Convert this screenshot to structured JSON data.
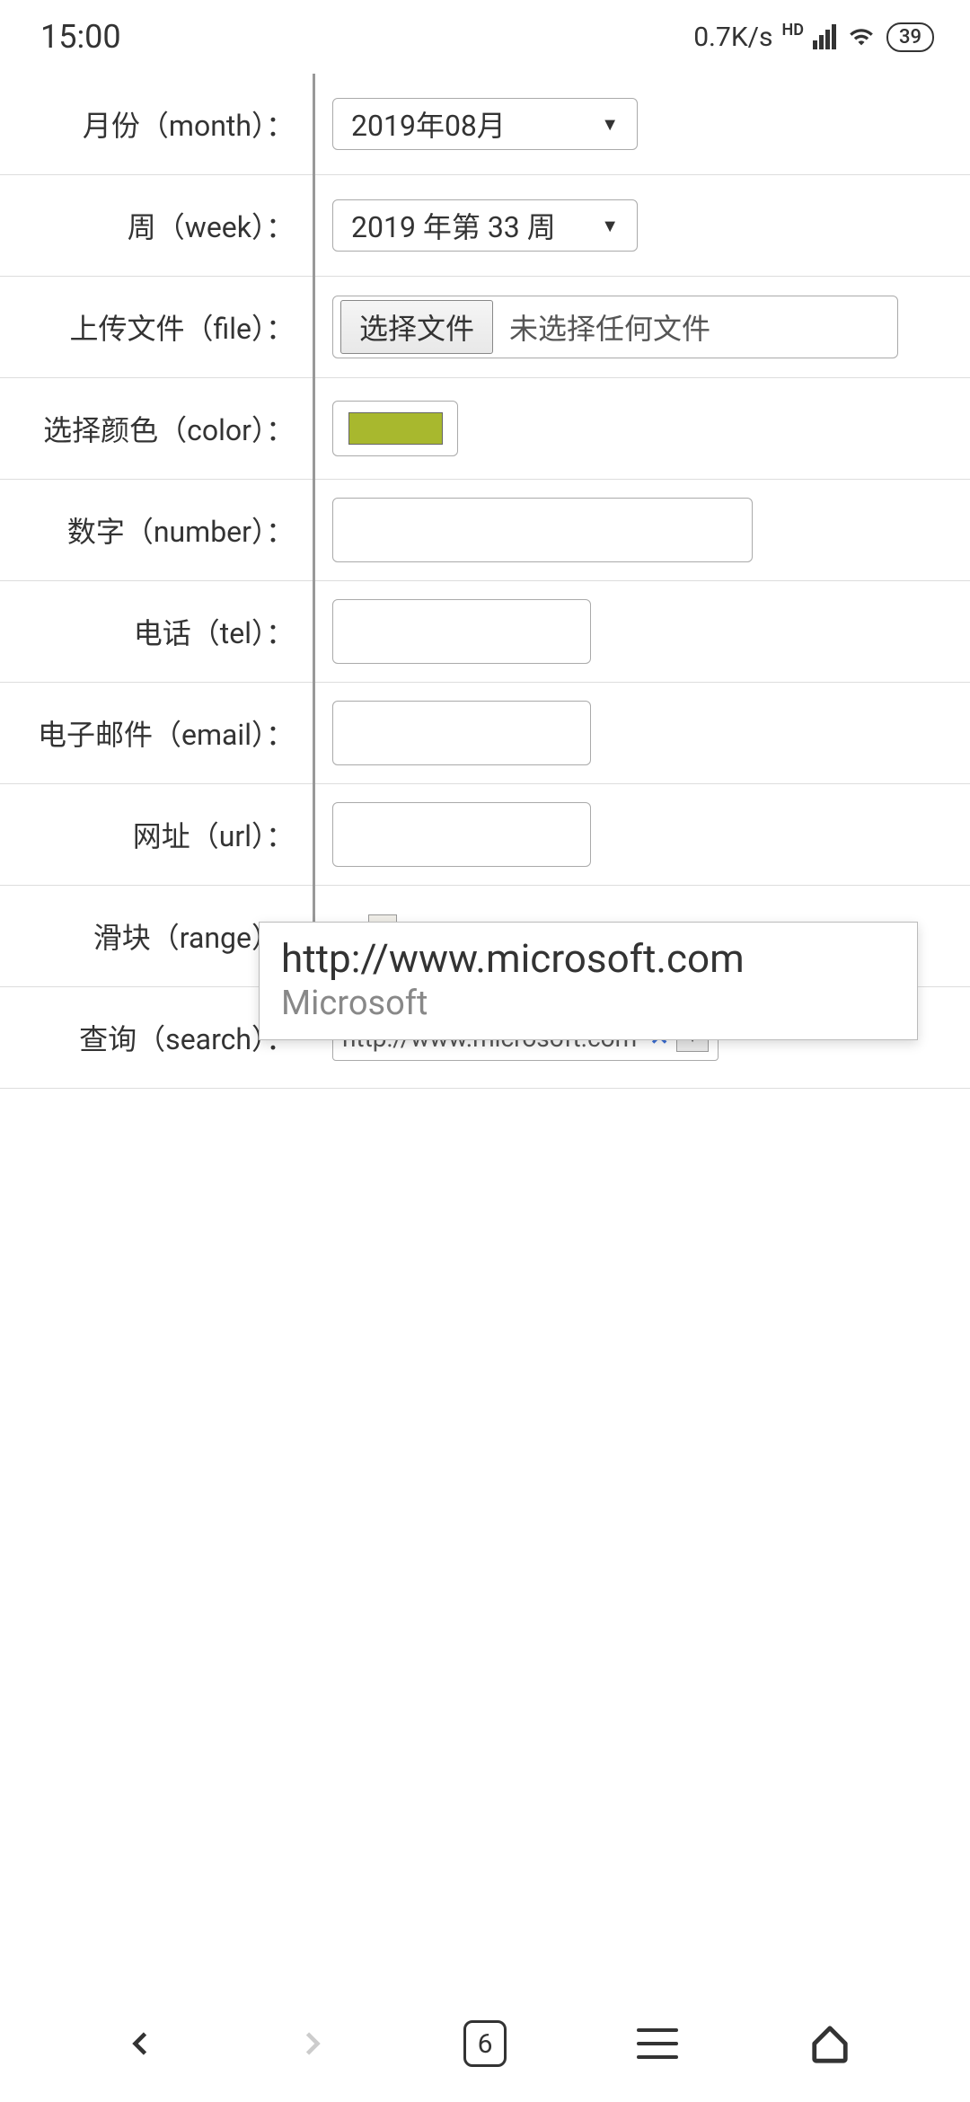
{
  "status": {
    "time": "15:00",
    "speed": "0.7K/s",
    "hd": "HD",
    "battery": "39"
  },
  "form": {
    "month": {
      "label": "月份（month）：",
      "value": "2019年08月"
    },
    "week": {
      "label": "周（week）：",
      "value": "2019 年第 33 周"
    },
    "file": {
      "label": "上传文件（file）：",
      "button": "选择文件",
      "status": "未选择任何文件"
    },
    "color": {
      "label": "选择颜色（color）：",
      "value": "#a8b82e"
    },
    "number": {
      "label": "数字（number）：",
      "value": ""
    },
    "tel": {
      "label": "电话（tel）：",
      "value": ""
    },
    "email": {
      "label": "电子邮件（email）：",
      "value": ""
    },
    "url": {
      "label": "网址（url）：",
      "value": ""
    },
    "range": {
      "label": "滑块（range）："
    },
    "search": {
      "label": "查询（search）：",
      "value": "http://www.microsoft.com"
    }
  },
  "autocomplete": {
    "url": "http://www.microsoft.com",
    "title": "Microsoft"
  },
  "nav": {
    "tabs": "6"
  }
}
